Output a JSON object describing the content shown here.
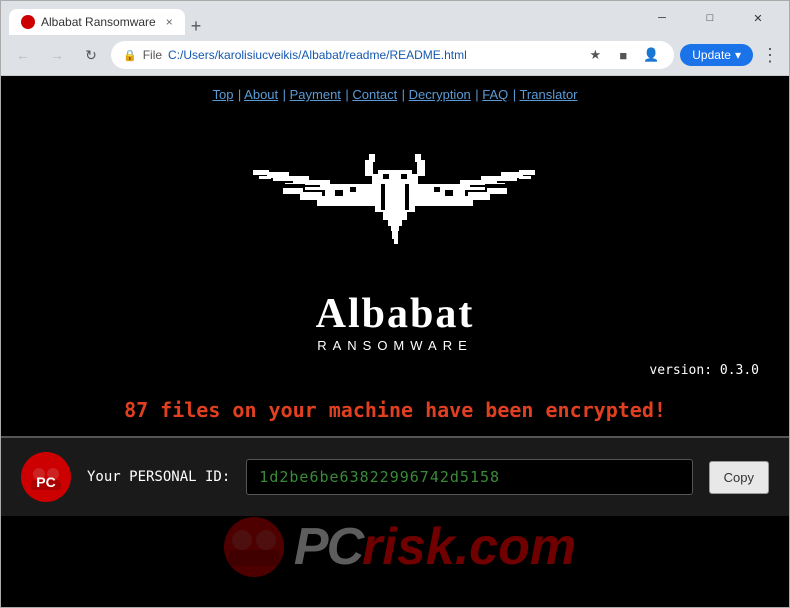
{
  "browser": {
    "tab": {
      "title": "Albabat Ransomware",
      "close_label": "×"
    },
    "new_tab_label": "+",
    "address": {
      "file_label": "File",
      "url": "C:/Users/karolisiucveikis/Albabat/readme/README.html"
    },
    "window_controls": {
      "minimize": "─",
      "maximize": "□",
      "close": "✕"
    },
    "update_btn": "Update"
  },
  "page": {
    "nav_links": [
      "Top",
      "About",
      "Payment",
      "Contact",
      "Decryption",
      "FAQ",
      "Translator"
    ],
    "nav_separator": "|",
    "brand_name": "Albabat",
    "brand_sub": "RANSOMWARE",
    "version": "version: 0.3.0",
    "encrypted_message": "87 files on your machine have been encrypted!",
    "personal_id_label": "Your PERSONAL ID:",
    "personal_id_value": "1d2be6be63822996742d5158",
    "copy_button": "Copy",
    "watermark_text": "risk.com",
    "accent_color": "#e04020",
    "pid_color": "#3a8a3a"
  }
}
